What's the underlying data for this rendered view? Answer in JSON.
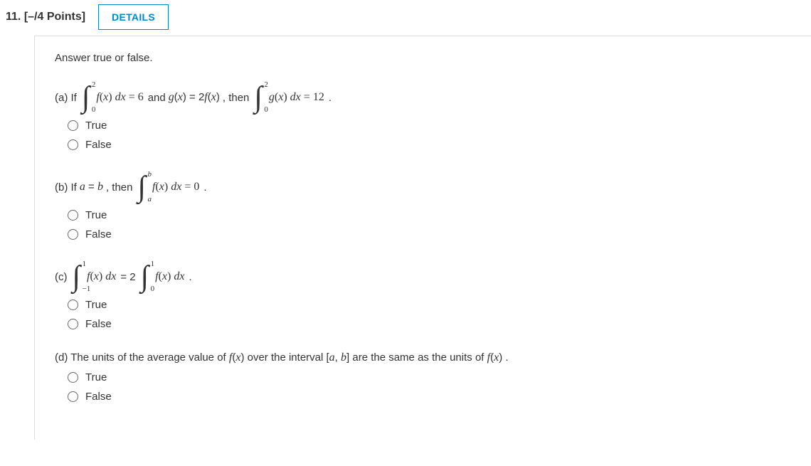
{
  "header": {
    "number": "11.",
    "points": "[–/4 Points]",
    "details": "DETAILS"
  },
  "prompt": "Answer true or false.",
  "choices": {
    "true": "True",
    "false": "False"
  },
  "parts": {
    "a": {
      "label": "(a) If",
      "int1": {
        "lower": "0",
        "upper": "2",
        "body_fn": "f",
        "body_rhs_val": "6"
      },
      "mid1": "  and  ",
      "gfx": {
        "g": "g",
        "paren_var": "x",
        "eq": " = 2",
        "f": "f",
        "paren_var2": "x"
      },
      "then": " ,  then",
      "int2": {
        "lower": "0",
        "upper": "2",
        "body_fn": "g",
        "body_rhs_val": "12"
      },
      "end": " ."
    },
    "b": {
      "label": "(b) If ",
      "eq": {
        "a": "a",
        "eq": " = ",
        "b": "b"
      },
      "then": ", then",
      "int": {
        "lower": "a",
        "upper": "b",
        "body_fn": "f",
        "body_rhs_val": "0"
      },
      "end": " ."
    },
    "c": {
      "label": "(c)",
      "int1": {
        "lower": "−1",
        "upper": "1",
        "body_fn": "f"
      },
      "eq": " = 2",
      "int2": {
        "lower": "0",
        "upper": "1",
        "body_fn": "f"
      },
      "end": " ."
    },
    "d": {
      "pre": "(d) The units of the average value of  ",
      "f": "f",
      "x": "x",
      "mid": "  over the interval  [",
      "a": "a",
      "comma": ", ",
      "b": "b",
      "post1": "]  are the same as the units of  ",
      "f2": "f",
      "x2": "x",
      "end": " ."
    }
  }
}
